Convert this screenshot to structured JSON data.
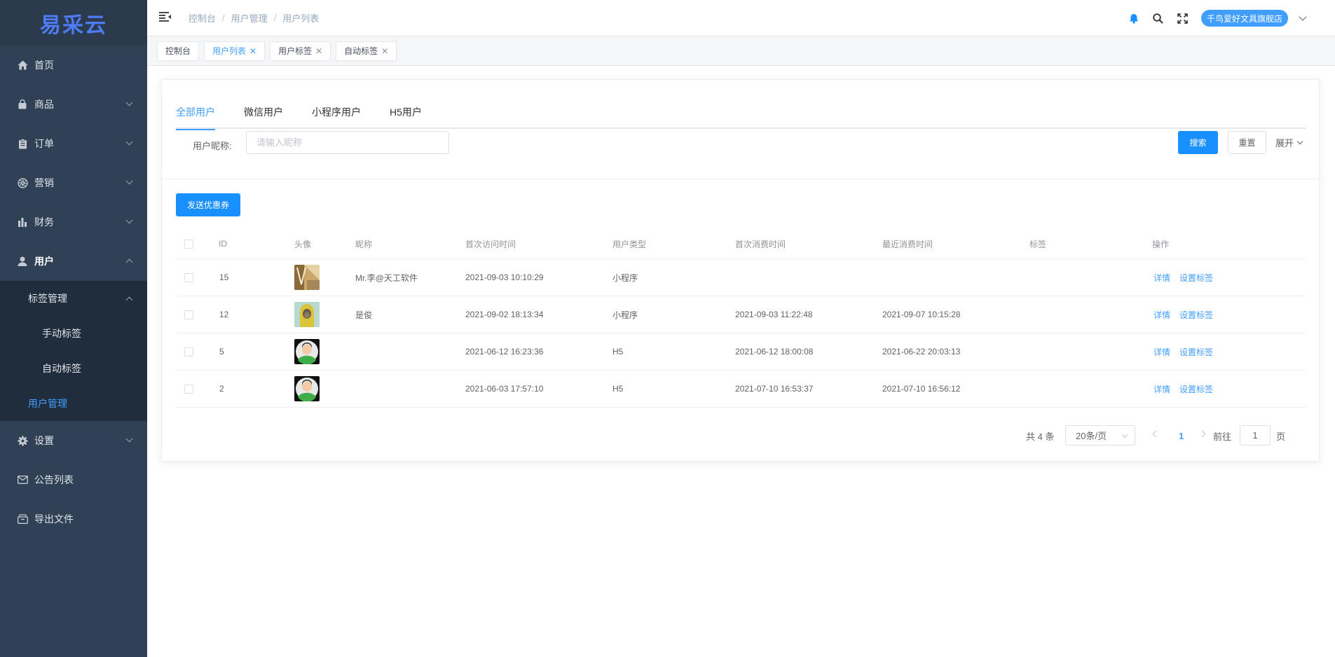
{
  "logo": "易采云",
  "sidebar": {
    "items": [
      {
        "label": "首页",
        "icon": "home-icon"
      },
      {
        "label": "商品",
        "icon": "bag-icon"
      },
      {
        "label": "订单",
        "icon": "clipboard-icon"
      },
      {
        "label": "营销",
        "icon": "aperture-icon"
      },
      {
        "label": "财务",
        "icon": "bar-chart-icon"
      },
      {
        "label": "用户",
        "icon": "user-icon"
      },
      {
        "label": "设置",
        "icon": "gear-icon"
      },
      {
        "label": "公告列表",
        "icon": "mail-icon"
      },
      {
        "label": "导出文件",
        "icon": "box-icon"
      }
    ],
    "user_sub": {
      "tag_mgmt": "标签管理",
      "manual_tag": "手动标签",
      "auto_tag": "自动标签",
      "user_mgmt": "用户管理"
    }
  },
  "header": {
    "breadcrumb": [
      "控制台",
      "用户管理",
      "用户列表"
    ],
    "separator": "/",
    "store_name": "千鸟爱好文具旗舰店"
  },
  "tags_bar": [
    {
      "label": "控制台",
      "closable": false,
      "active": false
    },
    {
      "label": "用户列表",
      "closable": true,
      "active": true
    },
    {
      "label": "用户标签",
      "closable": true,
      "active": false
    },
    {
      "label": "自动标签",
      "closable": true,
      "active": false
    }
  ],
  "tabs": [
    "全部用户",
    "微信用户",
    "小程序用户",
    "H5用户"
  ],
  "filter": {
    "label": "用户昵称:",
    "placeholder": "请输入昵称",
    "search": "搜索",
    "reset": "重置",
    "expand": "展开"
  },
  "send_coupon": "发送优惠券",
  "table": {
    "headers": [
      "ID",
      "头像",
      "昵称",
      "首次访问时间",
      "用户类型",
      "首次消费时间",
      "最近消费时间",
      "标签",
      "操作"
    ],
    "rows": [
      {
        "id": "15",
        "avatar": "photo-avatar",
        "nickname": "Mr.李@天工软件",
        "first_visit": "2021-09-03 10:10:29",
        "type": "小程序",
        "first_purchase": "",
        "last_purchase": "",
        "tag": ""
      },
      {
        "id": "12",
        "avatar": "photo-avatar",
        "nickname": "是俊",
        "first_visit": "2021-09-02 18:13:34",
        "type": "小程序",
        "first_purchase": "2021-09-03 11:22:48",
        "last_purchase": "2021-09-07 10:15:28",
        "tag": ""
      },
      {
        "id": "5",
        "avatar": "default-avatar",
        "nickname": "",
        "first_visit": "2021-06-12 16:23:36",
        "type": "H5",
        "first_purchase": "2021-06-12 18:00:08",
        "last_purchase": "2021-06-22 20:03:13",
        "tag": ""
      },
      {
        "id": "2",
        "avatar": "default-avatar",
        "nickname": "",
        "first_visit": "2021-06-03 17:57:10",
        "type": "H5",
        "first_purchase": "2021-07-10 16:53:37",
        "last_purchase": "2021-07-10 16:56:12",
        "tag": ""
      }
    ],
    "actions": {
      "detail": "详情",
      "set_tag": "设置标签"
    }
  },
  "pagination": {
    "total": "共 4 条",
    "page_size": "20条/页",
    "current": "1",
    "goto_prefix": "前往",
    "goto_value": "1",
    "goto_suffix": "页"
  },
  "colors": {
    "sidebar_bg": "#304156",
    "submenu_bg": "#1f2d3d",
    "primary": "#409eff",
    "button_blue": "#1890ff",
    "logo": "#4e7cf6"
  }
}
